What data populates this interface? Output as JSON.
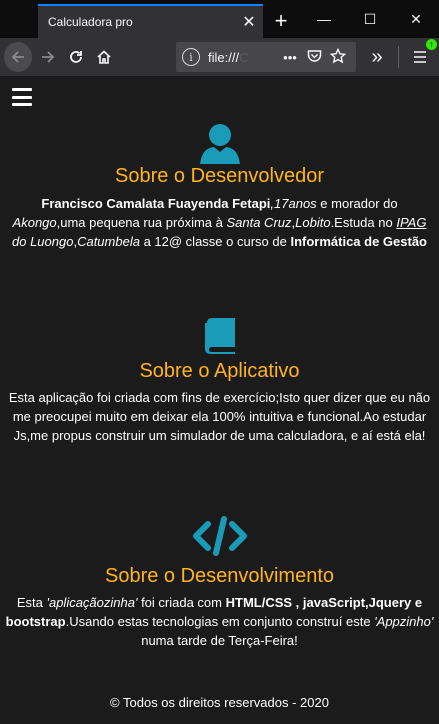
{
  "browser": {
    "tab_title": "Calculadora pro",
    "tab_close": "✕",
    "new_tab": "+",
    "window_minimize": "—",
    "window_maximize": "☐",
    "window_close": "✕",
    "url_prefix": "file:///",
    "url_obscured": "C",
    "url_more": "•••",
    "overflow": "»"
  },
  "page": {
    "about_dev": {
      "title": "Sobre o Desenvolvedor",
      "name": "Francisco Camalata Fuayenda Fetapi",
      "age": "17anos",
      "t1": " e morador do ",
      "place1": "Akongo",
      "t2": ",uma pequena rua próxima à ",
      "place2": "Santa Cruz",
      "t3": ",",
      "place3": "Lobito",
      "t4": ".Estuda no ",
      "school": "IPAG",
      "place4": " do Luongo",
      "t5": ",",
      "place5": "Catumbela",
      "t6": " a 12@ classe o curso de ",
      "course": "Informática de Gestão"
    },
    "about_app": {
      "title": "Sobre o Aplicativo",
      "text": "Esta aplicação foi criada com fins de exercício;Isto quer dizer que eu não me preocupei muito em deixar ela 100% intuitiva e funcional.Ao estudar Js,me propus construir um simulador de uma calculadora, e aí está ela!"
    },
    "about_dev_tools": {
      "title": "Sobre o Desenvolvimento",
      "t1": "Esta ",
      "app_nick": "'aplicaçãozinha'",
      "t2": " foi criada com ",
      "tech1": "HTML/CSS , javaScript,Jquery e bootstrap",
      "t3": ".Usando estas tecnologias em conjunto construí este ",
      "app_nick2": "'Appzinho'",
      "t4": " numa tarde de Terça-Feira!"
    },
    "footer": "© Todos os direitos reservados - 2020"
  },
  "colors": {
    "accent": "#ffb41e",
    "icon": "#1a9bb8",
    "background": "#1b1b1b"
  }
}
